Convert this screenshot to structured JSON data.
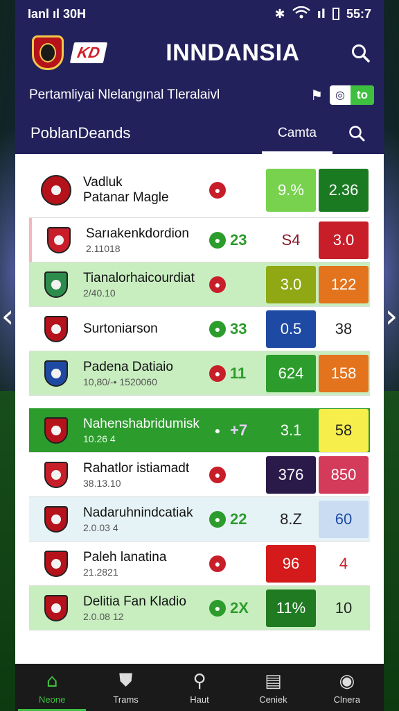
{
  "status": {
    "signal": "Ianl ıl 30H",
    "time": "55:7"
  },
  "header": {
    "brand": "KD",
    "title": "INNDANSIA"
  },
  "subbar": {
    "subtitle": "Pertamliyai Nlelangınal Tleralaivl",
    "toggle_right": "to"
  },
  "tabs": {
    "section": "PoblanDeands",
    "active_tab": "Camta"
  },
  "rows": [
    {
      "name": "Vadluk",
      "name2": "Patanar Magle",
      "sub": "",
      "mini": "",
      "box1": "9.%",
      "box2": "2.36",
      "c1": "#78d24e",
      "c2": "#1a7a22",
      "t1": "#fff",
      "t2": "#fff",
      "badge": "#b5121b",
      "style": "tall"
    },
    {
      "name": "Sarıakenkdordion",
      "sub": "2.11018",
      "mini": "23",
      "box1": "S4",
      "box2": "3.0",
      "c1": "transparent",
      "c2": "#c81e2a",
      "t1": "#8a1a2a",
      "t2": "#fff",
      "badge": "#c81e2a",
      "style": "pink"
    },
    {
      "name": "Tianalorhaicourdiat",
      "sub": "2/40.10",
      "mini": "",
      "box1": "3.0",
      "box2": "122",
      "c1": "#8fa814",
      "c2": "#e3731c",
      "t1": "#fff",
      "t2": "#fff",
      "badge": "#2c8c4c",
      "style": "hl"
    },
    {
      "name": "Surtoniarson",
      "sub": "",
      "mini": "33",
      "box1": "0.5",
      "box2": "38",
      "c1": "#1f4aa3",
      "c2": "transparent",
      "t1": "#fff",
      "t2": "#222",
      "badge": "#b5121b",
      "style": ""
    },
    {
      "name": "Padena Datiaio",
      "sub": "10,80/-• 1520060",
      "mini": "11",
      "box1": "624",
      "box2": "158",
      "c1": "#2c9c2c",
      "c2": "#e3731c",
      "t1": "#fff",
      "t2": "#fff",
      "badge": "#1f4aa3",
      "style": "hl"
    },
    {
      "name": "Nahenshabridumisk",
      "sub": "10.26 4",
      "mini": "+7",
      "box1": "3.1",
      "box2": "58",
      "c1": "transparent",
      "c2": "#f6ee4a",
      "t1": "#fff",
      "t2": "#222",
      "badge": "#b5121b",
      "style": "dark"
    },
    {
      "name": "Rahatlor istiamadt",
      "sub": "38.13.10",
      "mini": "",
      "box1": "376",
      "box2": "850",
      "c1": "#2a1a4a",
      "c2": "#d43a5a",
      "t1": "#fff",
      "t2": "#fff",
      "badge": "#c81e2a",
      "style": ""
    },
    {
      "name": "Nadaruhnindcatiak",
      "sub": "2.0.03 4",
      "mini": "22",
      "box1": "8.Z",
      "box2": "60",
      "c1": "transparent",
      "c2": "#c9dcf2",
      "t1": "#222",
      "t2": "#1f4aa3",
      "badge": "#b5121b",
      "style": "blue"
    },
    {
      "name": "Paleh lanatina",
      "sub": "21.2821",
      "mini": "",
      "box1": "96",
      "box2": "4",
      "c1": "#d41a1a",
      "c2": "transparent",
      "t1": "#fff",
      "t2": "#c81e2a",
      "badge": "#b5121b",
      "style": ""
    },
    {
      "name": "Delitia Fan Kladio",
      "sub": "2.0.08 12",
      "mini": "2X",
      "box1": "11%",
      "box2": "10",
      "c1": "#1f7a22",
      "c2": "transparent",
      "t1": "#fff",
      "t2": "#222",
      "badge": "#b5121b",
      "style": "hl"
    }
  ],
  "nav": [
    {
      "label": "Neone",
      "icon": "home-icon"
    },
    {
      "label": "Trams",
      "icon": "team-icon"
    },
    {
      "label": "Haut",
      "icon": "search-icon"
    },
    {
      "label": "Ceniek",
      "icon": "calendar-icon"
    },
    {
      "label": "Clnera",
      "icon": "profile-icon"
    }
  ]
}
